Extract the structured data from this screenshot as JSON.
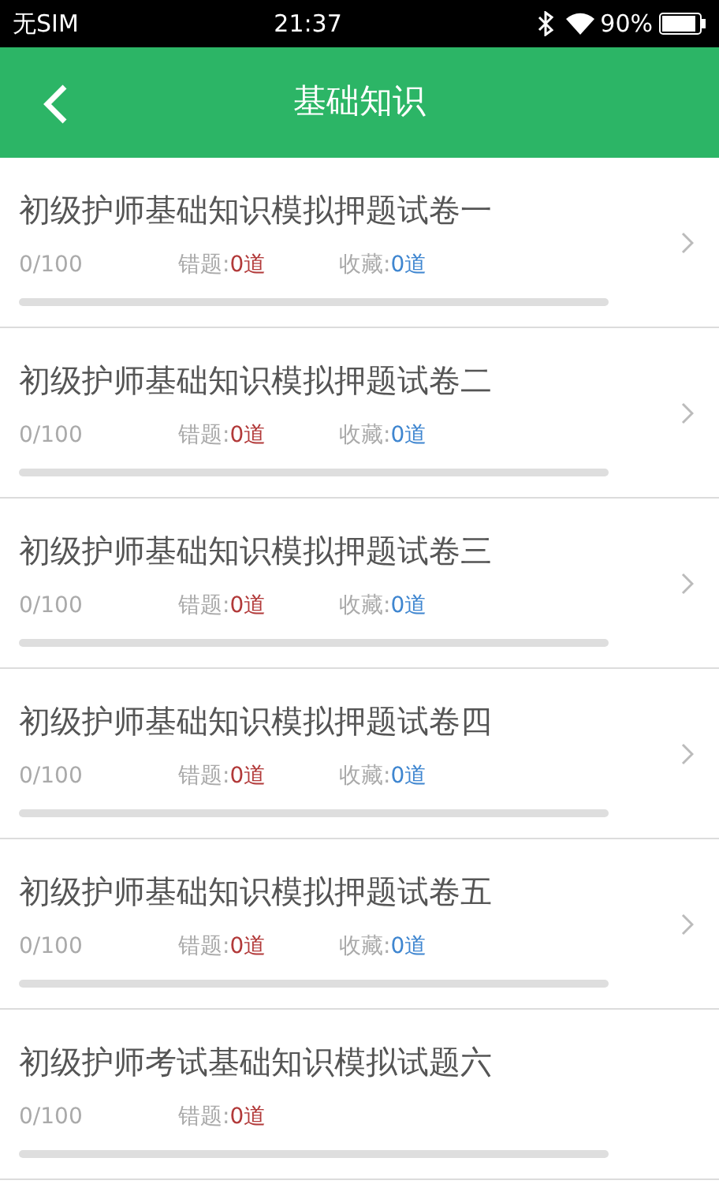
{
  "status_bar": {
    "carrier": "无SIM",
    "time": "21:37",
    "battery": "90%"
  },
  "header": {
    "title": "基础知识"
  },
  "papers": [
    {
      "title": "初级护师基础知识模拟押题试卷一",
      "progress": "0/100",
      "level": 0,
      "wrong_label": "错题:",
      "wrong_count": "0道",
      "fav_label": "收藏:",
      "fav_count": "0道",
      "arrow": true
    },
    {
      "title": "初级护师基础知识模拟押题试卷二",
      "progress": "0/100",
      "level": 0,
      "wrong_label": "错题:",
      "wrong_count": "0道",
      "fav_label": "收藏:",
      "fav_count": "0道",
      "arrow": true
    },
    {
      "title": "初级护师基础知识模拟押题试卷三",
      "progress": "0/100",
      "level": 0,
      "wrong_label": "错题:",
      "wrong_count": "0道",
      "fav_label": "收藏:",
      "fav_count": "0道",
      "arrow": true
    },
    {
      "title": "初级护师基础知识模拟押题试卷四",
      "progress": "0/100",
      "level": 0,
      "wrong_label": "错题:",
      "wrong_count": "0道",
      "fav_label": "收藏:",
      "fav_count": "0道",
      "arrow": true
    },
    {
      "title": "初级护师基础知识模拟押题试卷五",
      "progress": "0/100",
      "level": 0,
      "wrong_label": "错题:",
      "wrong_count": "0道",
      "fav_label": "收藏:",
      "fav_count": "0道",
      "arrow": true
    },
    {
      "title": "初级护师考试基础知识模拟试题六",
      "progress": "0/100",
      "level": 0,
      "wrong_label": "错题:",
      "wrong_count": "0道",
      "arrow": false
    }
  ]
}
